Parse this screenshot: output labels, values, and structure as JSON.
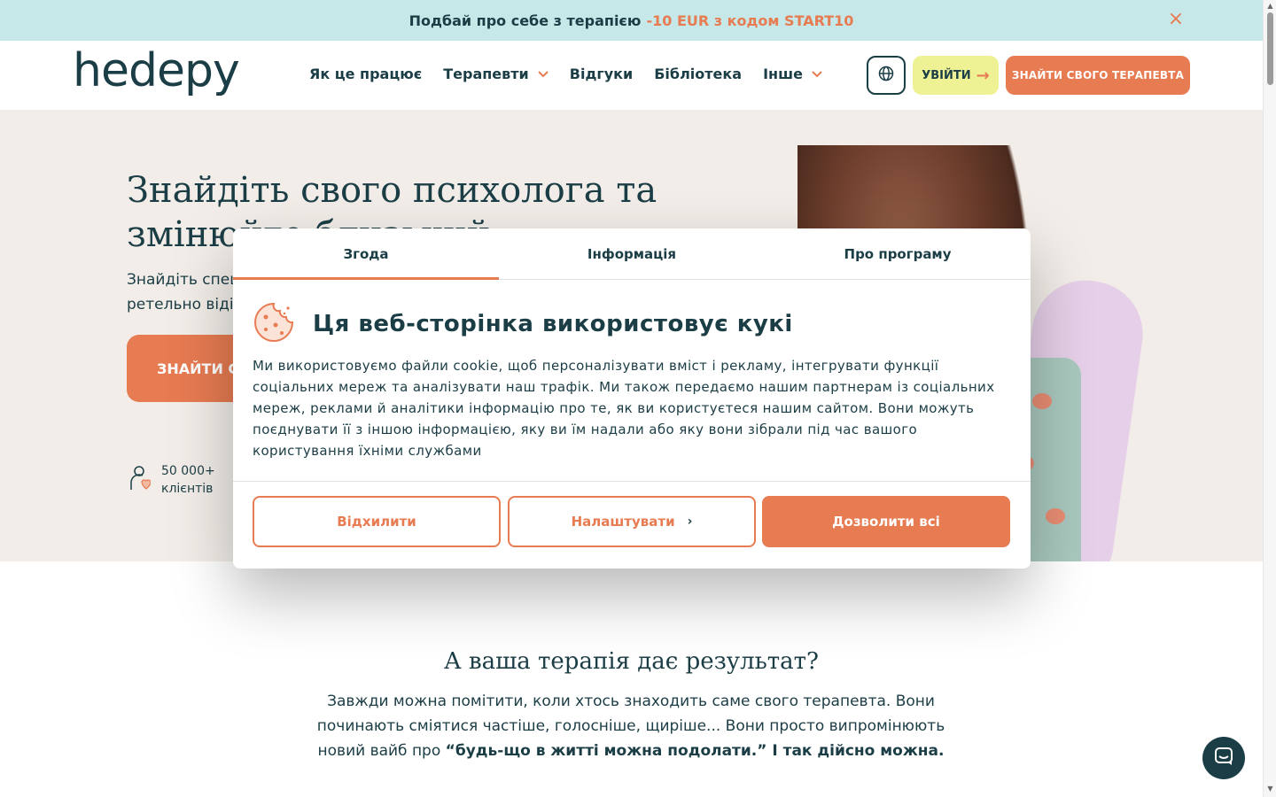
{
  "promo": {
    "text": "Подбай про себе з терапією",
    "accent": "-10 EUR з кодом START10 ",
    "close_icon": "close-icon"
  },
  "header": {
    "logo": "hedepy",
    "nav": [
      {
        "label": "Як це працює",
        "has_dropdown": false
      },
      {
        "label": "Терапевти",
        "has_dropdown": true
      },
      {
        "label": "Відгуки",
        "has_dropdown": false
      },
      {
        "label": "Бібліотека",
        "has_dropdown": false
      },
      {
        "label": "Інше",
        "has_dropdown": true
      }
    ],
    "login_label": "УВІЙТИ",
    "find_label": "ЗНАЙТИ СВОГО ТЕРАПЕВТА"
  },
  "hero": {
    "title_line1": "Знайдіть свого психолога та",
    "title_line2": "змінюйте близький",
    "subtitle_line1": "Знайдіть спеціаліста",
    "subtitle_line2": "ретельно відібраних",
    "cta_label": "ЗНАЙТИ СВОГО",
    "stat_value": "50 000+",
    "stat_label": "клієнтів"
  },
  "results": {
    "title": "А ваша терапія дає результат?",
    "body_plain": "Завжди можна помітити, коли хтось знаходить саме свого терапевта. Вони починають сміятися частіше, голосніше, щиріше... Вони просто випромінюють новий вайб про ",
    "body_bold": "“будь-що в житті можна подолати.” І так дійсно можна."
  },
  "cookie_modal": {
    "tabs": [
      {
        "label": "Згода",
        "active": true
      },
      {
        "label": "Інформація",
        "active": false
      },
      {
        "label": "Про програму",
        "active": false
      }
    ],
    "title": "Ця веб-сторінка використовує кукі",
    "text": "Ми використовуємо файли cookie, щоб персоналізувати вміст і рекламу, інтегрувати функції соціальних мереж та аналізувати наш трафік. Ми також передаємо нашим партнерам із соціальних мереж, реклами й аналітики інформацію про те, як ви користуєтеся нашим сайтом. Вони можуть поєднувати її з іншою інформацією, яку ви їм надали або яку вони зібрали під час вашого користування їхніми службами",
    "decline_label": "Відхилити",
    "customize_label": "Налаштувати",
    "allow_label": "Дозволити всі"
  },
  "colors": {
    "brand_dark": "#1b3d45",
    "accent": "#e77b52",
    "promo_bg": "#c6e8e8",
    "hero_bg": "#f2ede8",
    "login_bg": "#eef295"
  }
}
